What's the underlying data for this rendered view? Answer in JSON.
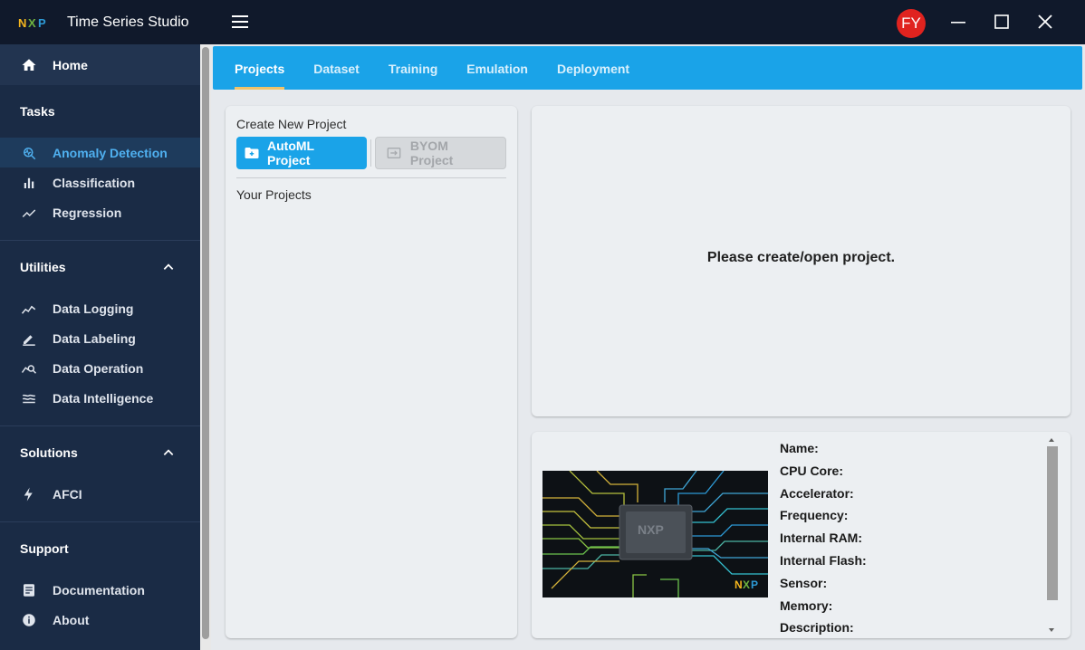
{
  "app": {
    "title": "Time Series Studio",
    "logo": "NXP"
  },
  "sidebar": {
    "home": "Home",
    "tasks": {
      "header": "Tasks",
      "items": [
        {
          "label": "Anomaly Detection",
          "icon": "anomaly-search-icon",
          "active": true
        },
        {
          "label": "Classification",
          "icon": "bar-chart-icon"
        },
        {
          "label": "Regression",
          "icon": "trend-line-icon"
        }
      ]
    },
    "utilities": {
      "header": "Utilities",
      "items": [
        {
          "label": "Data Logging",
          "icon": "line-chart-icon"
        },
        {
          "label": "Data Labeling",
          "icon": "pencil-icon"
        },
        {
          "label": "Data Operation",
          "icon": "data-search-icon"
        },
        {
          "label": "Data Intelligence",
          "icon": "waves-icon"
        }
      ]
    },
    "solutions": {
      "header": "Solutions",
      "items": [
        {
          "label": "AFCI",
          "icon": "lightning-icon"
        }
      ]
    },
    "support": {
      "header": "Support",
      "items": [
        {
          "label": "Documentation",
          "icon": "document-icon"
        },
        {
          "label": "About",
          "icon": "info-icon"
        }
      ]
    }
  },
  "topbar": {
    "avatar_initials": "FY"
  },
  "tabs": [
    "Projects",
    "Dataset",
    "Training",
    "Emulation",
    "Deployment"
  ],
  "projects": {
    "create_label": "Create New Project",
    "automl_button": "AutoML Project",
    "byom_button": "BYOM Project",
    "your_projects_label": "Your Projects"
  },
  "status_message": "Please create/open project.",
  "device_specs": [
    "Name:",
    "CPU Core:",
    "Accelerator:",
    "Frequency:",
    "Internal RAM:",
    "Internal Flash:",
    "Sensor:",
    "Memory:",
    "Description:"
  ],
  "colors": {
    "accent": "#1aa3e8",
    "sidebar": "#1a2b45",
    "topbar": "#10192b",
    "avatar": "#e0231f",
    "active_tab_underline": "#f0c36a"
  }
}
